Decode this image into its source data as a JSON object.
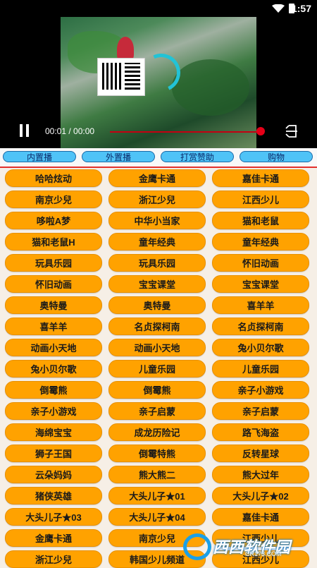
{
  "status_bar": {
    "time": "1:57"
  },
  "player": {
    "time_display": "00:01 / 00:00",
    "progress_fraction": 0.98
  },
  "tabs": [
    "内置播",
    "外置播",
    "打赏赞助",
    "购物"
  ],
  "items": [
    [
      "哈哈炫动",
      "金鹰卡通",
      "嘉佳卡通"
    ],
    [
      "南京少兒",
      "浙江少兒",
      "江西少儿"
    ],
    [
      "哆啦A梦",
      "中华小当家",
      "猫和老鼠"
    ],
    [
      "猫和老鼠H",
      "童年经典",
      "童年经典"
    ],
    [
      "玩具乐园",
      "玩具乐园",
      "怀旧动画"
    ],
    [
      "怀旧动画",
      "宝宝课堂",
      "宝宝课堂"
    ],
    [
      "奥特曼",
      "奥特曼",
      "喜羊羊"
    ],
    [
      "喜羊羊",
      "名贞探柯南",
      "名贞探柯南"
    ],
    [
      "动画小天地",
      "动画小天地",
      "兔小贝尔歌"
    ],
    [
      "兔小贝尔歌",
      "儿童乐园",
      "儿童乐园"
    ],
    [
      "倒霉熊",
      "倒霉熊",
      "亲子小游戏"
    ],
    [
      "亲子小游戏",
      "亲子启蒙",
      "亲子启蒙"
    ],
    [
      "海绵宝宝",
      "成龙历险记",
      "路飞海盗"
    ],
    [
      "狮子王国",
      "倒霉特熊",
      "反转星球"
    ],
    [
      "云朵妈妈",
      "熊大熊二",
      "熊大过年"
    ],
    [
      "猪侠英雄",
      "大头儿子★01",
      "大头儿子★02"
    ],
    [
      "大头儿子★03",
      "大头儿子★04",
      "嘉佳卡通"
    ],
    [
      "金鹰卡通",
      "南京少兒",
      "江西少儿"
    ],
    [
      "浙江少兒",
      "韩国少儿频道",
      "江西少儿"
    ]
  ],
  "watermark": {
    "text": "西西软件园",
    "sub": "CR173.COM"
  }
}
